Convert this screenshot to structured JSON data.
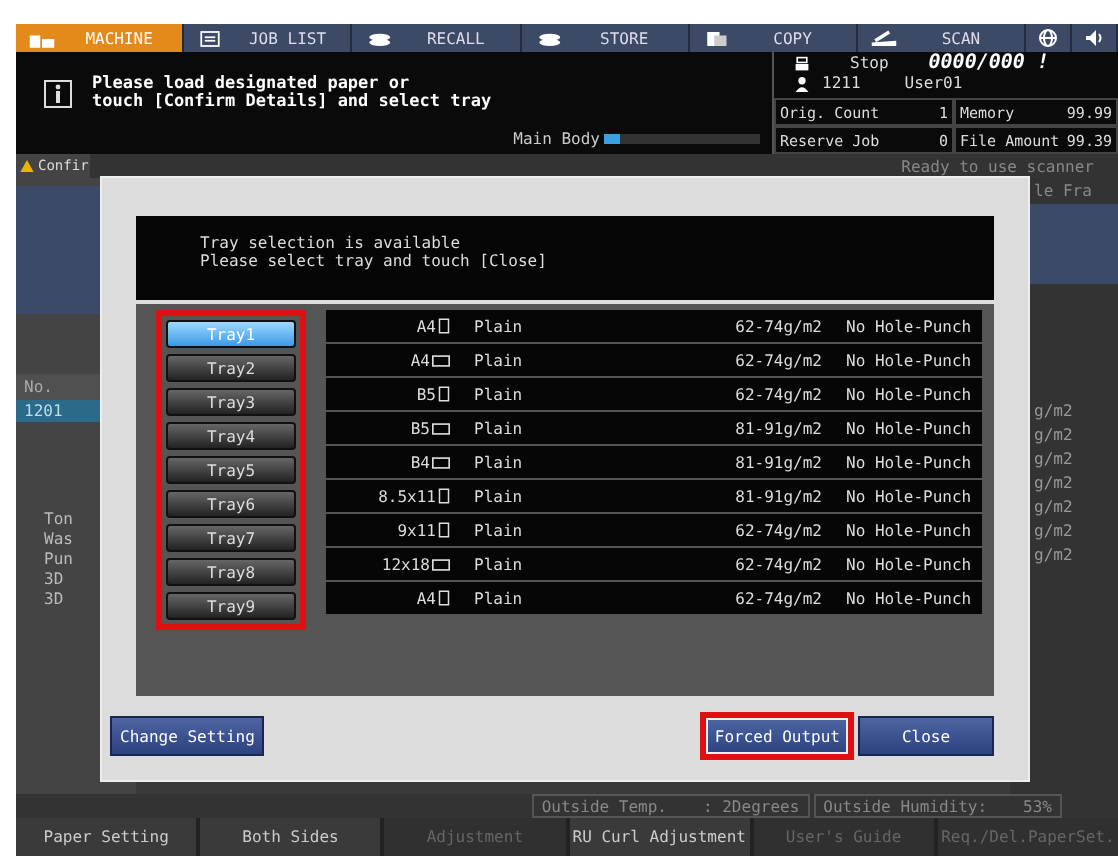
{
  "tabs": [
    {
      "label": "MACHINE",
      "selected": true
    },
    {
      "label": "JOB LIST",
      "selected": false
    },
    {
      "label": "RECALL",
      "selected": false
    },
    {
      "label": "STORE",
      "selected": false
    },
    {
      "label": "COPY",
      "selected": false
    },
    {
      "label": "SCAN",
      "selected": false
    },
    {
      "selected": false
    },
    {
      "selected": false
    }
  ],
  "message": {
    "lines": [
      "Please load designated paper or",
      "touch [Confirm Details] and select tray"
    ]
  },
  "main_body": {
    "label": "Main Body",
    "level": 0.1
  },
  "status": {
    "state": "Stop",
    "counter": "0000/000 !",
    "user_id": "1211",
    "user_name": "User01",
    "cells": [
      {
        "label": "Orig. Count",
        "value": "1"
      },
      {
        "label": "Memory",
        "value": "99.99"
      },
      {
        "label": "Reserve Job",
        "value": "0"
      },
      {
        "label": "File Amount",
        "value": "99.39"
      }
    ]
  },
  "background": {
    "warning_tab": "Confir",
    "ready_text": "Ready to use scanner",
    "right_header": "le Fra",
    "list_heading": "No.",
    "list_row": "1201",
    "side_items": [
      "Ton",
      "Was",
      "Pun",
      "3D",
      "3D"
    ],
    "right_units": [
      "g/m2",
      "g/m2",
      "g/m2",
      "g/m2",
      "g/m2",
      "g/m2",
      "g/m2"
    ]
  },
  "dialog": {
    "message": [
      "Tray selection is available",
      "Please select tray and touch [Close]"
    ],
    "trays": [
      {
        "label": "Tray1",
        "selected": true
      },
      {
        "label": "Tray2",
        "selected": false
      },
      {
        "label": "Tray3",
        "selected": false
      },
      {
        "label": "Tray4",
        "selected": false
      },
      {
        "label": "Tray5",
        "selected": false
      },
      {
        "label": "Tray6",
        "selected": false
      },
      {
        "label": "Tray7",
        "selected": false
      },
      {
        "label": "Tray8",
        "selected": false
      },
      {
        "label": "Tray9",
        "selected": false
      }
    ],
    "rows": [
      {
        "size": "A4",
        "kind": "portrait",
        "type": "Plain",
        "weight": "62-74g/m2",
        "punch": "No Hole-Punch"
      },
      {
        "size": "A4",
        "kind": "landscape",
        "type": "Plain",
        "weight": "62-74g/m2",
        "punch": "No Hole-Punch"
      },
      {
        "size": "B5",
        "kind": "portrait",
        "type": "Plain",
        "weight": "62-74g/m2",
        "punch": "No Hole-Punch"
      },
      {
        "size": "B5",
        "kind": "landscape",
        "type": "Plain",
        "weight": "81-91g/m2",
        "punch": "No Hole-Punch"
      },
      {
        "size": "B4",
        "kind": "landscape",
        "type": "Plain",
        "weight": "81-91g/m2",
        "punch": "No Hole-Punch"
      },
      {
        "size": "8.5x11",
        "kind": "portrait",
        "type": "Plain",
        "weight": "81-91g/m2",
        "punch": "No Hole-Punch"
      },
      {
        "size": "9x11",
        "kind": "portrait",
        "type": "Plain",
        "weight": "62-74g/m2",
        "punch": "No Hole-Punch"
      },
      {
        "size": "12x18",
        "kind": "landscape",
        "type": "Plain",
        "weight": "62-74g/m2",
        "punch": "No Hole-Punch"
      },
      {
        "size": "A4",
        "kind": "portrait",
        "type": "Plain",
        "weight": "62-74g/m2",
        "punch": "No Hole-Punch"
      }
    ],
    "buttons": [
      {
        "label": "Change Setting",
        "highlighted": false
      },
      {
        "label": "Forced Output",
        "highlighted": true
      },
      {
        "label": "Close",
        "highlighted": false
      }
    ]
  },
  "environment": [
    {
      "label": "Outside Temp.",
      "value": ": 2Degrees"
    },
    {
      "label": "Outside Humidity:",
      "value": "53%"
    }
  ],
  "bottom_tabs": [
    {
      "label": "Paper Setting",
      "disabled": false
    },
    {
      "label": "Both Sides",
      "disabled": false
    },
    {
      "label": "Adjustment",
      "disabled": true
    },
    {
      "label": "RU Curl Adjustment",
      "disabled": false
    },
    {
      "label": "User's Guide",
      "disabled": true
    },
    {
      "label": "Req./Del.PaperSet.",
      "disabled": true
    }
  ]
}
